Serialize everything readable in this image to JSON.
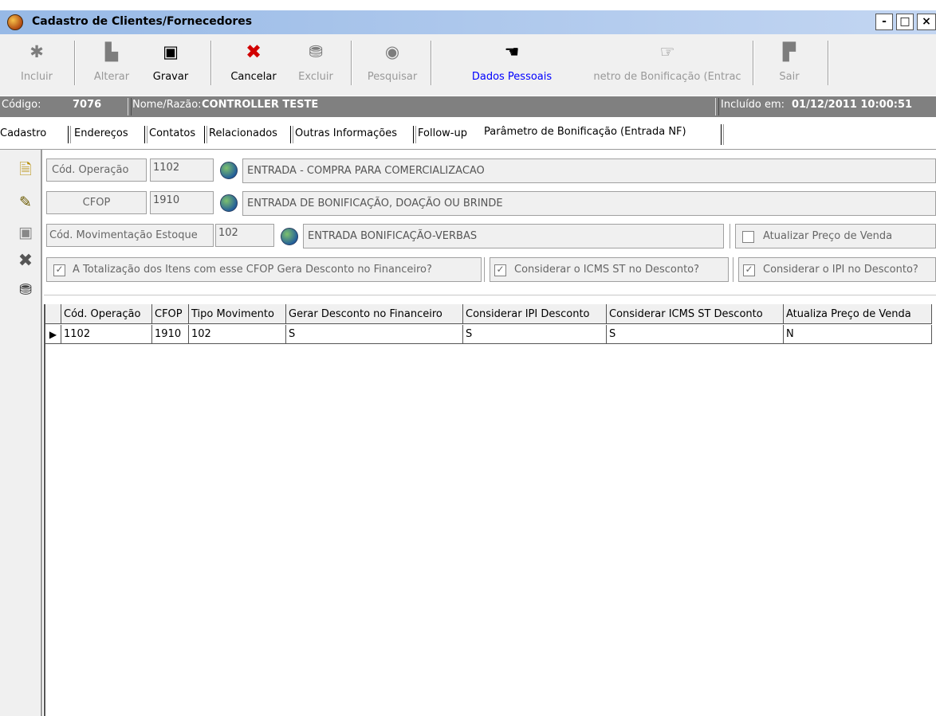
{
  "window": {
    "title": "Cadastro de Clientes/Fornecedores",
    "controls": [
      "-",
      "□",
      "×"
    ]
  },
  "toolbar": {
    "buttons": [
      {
        "label": "Incluir",
        "icon": "asterisk-icon",
        "enabled": false
      },
      {
        "label": "Alterar",
        "icon": "edit-icon",
        "enabled": false
      },
      {
        "label": "Gravar",
        "icon": "floppy-icon",
        "enabled": true
      },
      {
        "label": "Cancelar",
        "icon": "red-x-icon",
        "enabled": true
      },
      {
        "label": "Excluir",
        "icon": "trash-icon",
        "enabled": false
      },
      {
        "label": "Pesquisar",
        "icon": "magnifier-globe-icon",
        "enabled": false
      },
      {
        "label": "Dados Pessoais",
        "icon": "pointing-hand-left-icon",
        "enabled": true
      },
      {
        "label": "netro de Bonificação (Entrac",
        "icon": "pointing-hand-right-icon",
        "enabled": false
      },
      {
        "label": "Sair",
        "icon": "door-exit-icon",
        "enabled": false
      }
    ],
    "accent_color": "#0000ff"
  },
  "header": {
    "codigo_label": "Código:",
    "codigo_value": "7076",
    "nome_label": "Nome/Razão:",
    "nome_value": "CONTROLLER TESTE",
    "incluido_label": "Incluído em:",
    "incluido_value": "01/12/2011 10:00:51"
  },
  "tabs": [
    {
      "label": "Cadastro"
    },
    {
      "label": "Endereços"
    },
    {
      "label": "Contatos"
    },
    {
      "label": "Relacionados"
    },
    {
      "label": "Outras Informações"
    },
    {
      "label": "Follow-up"
    },
    {
      "label": "Parâmetro de Bonificação (Entrada NF)",
      "active": true
    }
  ],
  "form": {
    "operacao": {
      "label": "Cód. Operação",
      "value": "1102",
      "description": "ENTRADA - COMPRA PARA COMERCIALIZACAO"
    },
    "cfop": {
      "label": "CFOP",
      "value": "1910",
      "description": "ENTRADA DE BONIFICAÇÃO, DOAÇÃO OU BRINDE"
    },
    "movimentacao": {
      "label": "Cód. Movimentação Estoque",
      "value": "102",
      "description": "ENTRADA BONIFICAÇÃO-VERBAS"
    },
    "atualizar_preco": {
      "label": "Atualizar Preço de Venda",
      "checked": false
    },
    "gera_desconto": {
      "label": "A Totalização dos Itens com esse CFOP Gera Desconto no Financeiro?",
      "checked": true
    },
    "considerar_icms": {
      "label": "Considerar o ICMS ST no Desconto?",
      "checked": true
    },
    "considerar_ipi": {
      "label": "Considerar o IPI no Desconto?",
      "checked": true
    }
  },
  "sidebar": {
    "icons": [
      "new-document-icon",
      "edit-document-icon",
      "save-icon",
      "delete-x-icon",
      "trash-icon"
    ]
  },
  "grid": {
    "columns": [
      "Cód. Operação",
      "CFOP",
      "Tipo Movimento",
      "Gerar Desconto no Financeiro",
      "Considerar IPI Desconto",
      "Considerar ICMS ST Desconto",
      "Atualiza Preço de Venda"
    ],
    "rows": [
      [
        "1102",
        "1910",
        "102",
        "S",
        "S",
        "S",
        "N"
      ]
    ]
  }
}
